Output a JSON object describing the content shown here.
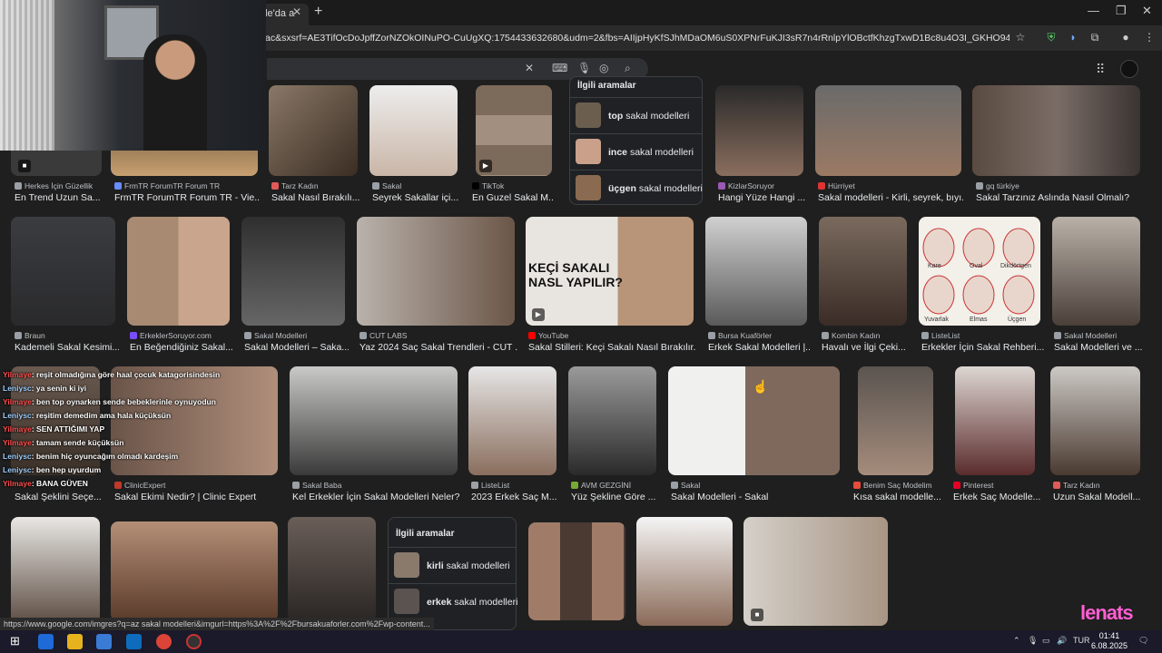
{
  "browser": {
    "tab_title": "gle'da a",
    "url": "ac&sxsrf=AE3TifOcDoJpffZorNZOkOINuPO-CuUgXQ:1754433632680&udm=2&fbs=AIIjpHyKfSJhMDaOM6uS0XPNrFuKJI3sR7n4rRnlpYlOBctfKhzgTxwD1Bc8u4O3I_GKHO94TMpWd2lxdVwhHaijGUI...",
    "status_url": "https://www.google.com/imgres?q=az sakal modelleri&imgurl=https%3A%2F%2Fbursakuaforler.com%2Fwp-content..."
  },
  "row1": [
    {
      "source": "Herkes İçin Güzellik",
      "title": "En Trend Uzun Sa..."
    },
    {
      "source": "FrmTR ForumTR Forum TR",
      "title": "FrmTR ForumTR Forum TR - Vie..."
    },
    {
      "source": "Tarz Kadın",
      "title": "Sakal Nasıl Bırakılı..."
    },
    {
      "source": "Sakal",
      "title": "Seyrek Sakallar içi..."
    },
    {
      "source": "TikTok",
      "title": "En Guzel Sakal M..."
    },
    {
      "source": "KizlarSoruyor",
      "title": "Hangi Yüze Hangi ..."
    },
    {
      "source": "Hürriyet",
      "title": "Sakal modelleri - Kirli, seyrek, bıyı..."
    },
    {
      "source": "gq türkiye",
      "title": "Sakal Tarzınız Aslında Nasıl Olmalı?"
    }
  ],
  "related1": {
    "header": "İlgili aramalar",
    "items": [
      {
        "bold": "top",
        "rest": "sakal modelleri"
      },
      {
        "bold": "ince",
        "rest": "sakal modelleri"
      },
      {
        "bold": "üçgen",
        "rest": "sakal modelleri"
      }
    ]
  },
  "row2": [
    {
      "source": "Braun",
      "title": "Kademeli Sakal Kesimi..."
    },
    {
      "source": "ErkeklerSoruyor.com",
      "title": "En Beğendiğiniz Sakal..."
    },
    {
      "source": "Sakal Modelleri",
      "title": "Sakal Modelleri – Saka..."
    },
    {
      "source": "CUT LABS",
      "title": "Yaz 2024 Saç Sakal Trendleri - CUT ..."
    },
    {
      "source": "YouTube",
      "title": "Sakal Stilleri: Keçi Sakalı Nasıl Bırakılır..."
    },
    {
      "source": "Bursa Kuaförler",
      "title": "Erkek Sakal Modelleri |..."
    },
    {
      "source": "Kombin Kadın",
      "title": "Havalı ve İlgi Çeki..."
    },
    {
      "source": "ListeList",
      "title": "Erkekler İçin Sakal Rehberi..."
    },
    {
      "source": "Sakal Modelleri",
      "title": "Sakal Modelleri ve ..."
    }
  ],
  "youtube_thumb_text": [
    "KEÇİ SAKALI",
    "NASL YAPILIR?"
  ],
  "face_shapes": [
    "Kare",
    "Oval",
    "Dikdörtgen",
    "Yuvarlak",
    "Elmas",
    "Üçgen"
  ],
  "row3": [
    {
      "source": "",
      "title": "Sakal Şeklini Seçe..."
    },
    {
      "source": "ClinicExpert",
      "title": "Sakal Ekimi Nedir? | Clinic Expert"
    },
    {
      "source": "Sakal Baba",
      "title": "Kel Erkekler İçin Sakal Modelleri Neler?"
    },
    {
      "source": "ListeList",
      "title": "2023 Erkek Saç M..."
    },
    {
      "source": "AVM GEZGİNİ",
      "title": "Yüz Şekline Göre ..."
    },
    {
      "source": "Sakal",
      "title": "Sakal Modelleri - Sakal"
    },
    {
      "source": "Benim Saç Modelim",
      "title": "Kısa sakal modelle..."
    },
    {
      "source": "Pinterest",
      "title": "Erkek Saç Modelle..."
    },
    {
      "source": "Tarz Kadın",
      "title": "Uzun Sakal Modell..."
    }
  ],
  "related2": {
    "header": "İlgili aramalar",
    "items": [
      {
        "bold": "kirli",
        "rest": "sakal modelleri"
      },
      {
        "bold": "erkek",
        "rest": "sakal modelleri"
      }
    ]
  },
  "chat": [
    {
      "user": "Yilmaye",
      "msg": ": reşit olmadığına göre haal çocuk katagorisindesin"
    },
    {
      "user": "Leniysc",
      "msg": ": ya senin ki iyi"
    },
    {
      "user": "Yilmaye",
      "msg": ": ben top oynarken sende bebeklerinle oynuyodun"
    },
    {
      "user": "Leniysc",
      "msg": ": reşitim demedim ama hala küçüksün"
    },
    {
      "user": "Yilmaye",
      "msg": ": SEN ATTIĞIMI YAP"
    },
    {
      "user": "Yilmaye",
      "msg": ": tamam sende küçüksün"
    },
    {
      "user": "Leniysc",
      "msg": ": benim hiç oyuncağım olmadı kardeşim"
    },
    {
      "user": "Leniysc",
      "msg": ": ben hep uyurdum"
    },
    {
      "user": "Yilmaye",
      "msg": ": BANA GÜVEN"
    }
  ],
  "taskbar": {
    "lang": "TUR",
    "time": "01:41",
    "date": "6.08.2025"
  },
  "brand": "lenats"
}
